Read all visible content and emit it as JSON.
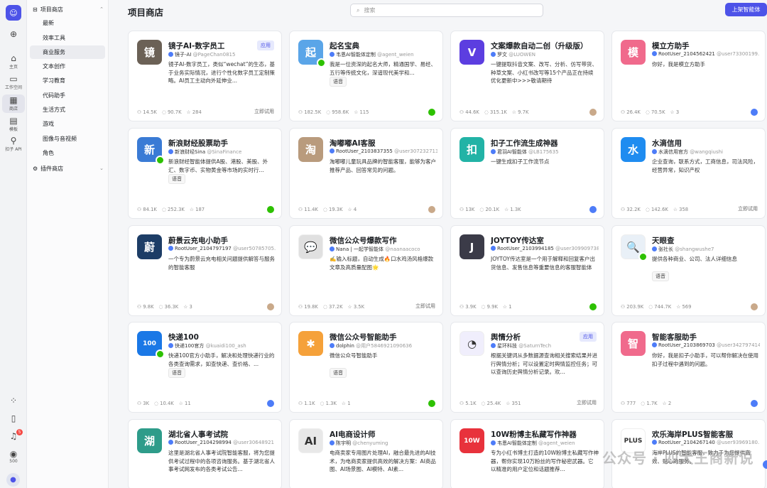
{
  "rail": {
    "items": [
      {
        "label": "主页",
        "icon": "home-icon"
      },
      {
        "label": "工作空间",
        "icon": "folder-icon"
      },
      {
        "label": "商店",
        "icon": "store-icon"
      },
      {
        "label": "模板",
        "icon": "template-icon"
      },
      {
        "label": "扣子 API",
        "icon": "api-icon"
      }
    ],
    "notif_count": "5",
    "points": "500"
  },
  "sidebar": {
    "project_store": "项目商店",
    "plugin_store": "插件商店",
    "items": [
      "最新",
      "效率工具",
      "商业服务",
      "文本创作",
      "学习教育",
      "代码助手",
      "生活方式",
      "游戏",
      "图像与音视频",
      "角色"
    ],
    "selected": 2
  },
  "header": {
    "title": "项目商店",
    "search_placeholder": "搜索",
    "publish_label": "上架智能体"
  },
  "cards": [
    {
      "name": "镜子AI-数字员工",
      "tag": "应用",
      "author": "镜子-AI",
      "handle": "@PageChan0815",
      "desc": "镜子AI-数字员工，类似“wechat”的生态，基于业务实际情况，进行个性化数字员工定制策略。AI员工主动向外延伸业...",
      "chip": "",
      "stats": [
        "14.5K",
        "90.7K",
        "284"
      ],
      "right": "立即试用",
      "icon_color": "#6b6156",
      "glyph": "镜",
      "wx": false
    },
    {
      "name": "起名宝典",
      "tag": "",
      "author": "韦恩AI智能体定制",
      "handle": "@agent_weien",
      "desc": "我是一位资深的起名大师，精通国学、易经、五行等传统文化，深谙现代美学和...",
      "chip": "语音",
      "stats": [
        "182.5K",
        "958.6K",
        "115"
      ],
      "right": "",
      "icon_color": "#5aa5e8",
      "glyph": "起",
      "wx": true
    },
    {
      "name": "文案爆款自动二创（升级版）",
      "tag": "",
      "author": "罗文",
      "handle": "@LUOWEN",
      "desc": "一键提取抖音文案、改写、分析、仿写带货、种草文案、小红书改写等15个产品正在持续优化更新中>>>敬请期待",
      "chip": "",
      "stats": [
        "44.6K",
        "315.1K",
        "9.7K"
      ],
      "right": "",
      "icon_color": "#5c3ee0",
      "glyph": "V",
      "wx": false
    },
    {
      "name": "模立方助手",
      "tag": "",
      "author": "RootUser_2104562421",
      "handle": "@user73300199...",
      "desc": "你好，我是模立方助手",
      "chip": "",
      "stats": [
        "26.4K",
        "70.5K",
        "3"
      ],
      "right": "",
      "icon_color": "#f06a8c",
      "glyph": "模",
      "wx": false
    },
    {
      "name": "新浪财经股票助手",
      "tag": "",
      "author": "新浪财经Sina",
      "handle": "@SinaFinance",
      "desc": "新浪财经智能体提供A股、港股、美股、外汇、数字币、实物黄金等市场的实时行...",
      "chip": "语音",
      "stats": [
        "84.1K",
        "252.3K",
        "187"
      ],
      "right": "",
      "icon_color": "#3a7bd5",
      "glyph": "新",
      "wx": true
    },
    {
      "name": "淘嘟嘟AI客服",
      "tag": "",
      "author": "RootUser_2103837355",
      "handle": "@user3072327131",
      "desc": "淘嘟嘟儿童玩具品牌的智能客服，能够为客户推荐产品、回答常见的问题。",
      "chip": "",
      "stats": [
        "11.4K",
        "19.3K",
        "4"
      ],
      "right": "",
      "icon_color": "#b99b7d",
      "glyph": "淘",
      "wx": false
    },
    {
      "name": "扣子工作流生成神器",
      "tag": "",
      "author": "君羽AI智能体",
      "handle": "@LB175635",
      "desc": "一键生成扣子工作流节点",
      "chip": "",
      "stats": [
        "13K",
        "20.1K",
        "1.3K"
      ],
      "right": "",
      "icon_color": "#22b3a6",
      "glyph": "扣",
      "wx": false
    },
    {
      "name": "水滴信用",
      "tag": "",
      "author": "水滴信用官方",
      "handle": "@wangqiushi",
      "desc": "企业查询，联系方式，工商信息，司法风险，经营异常，知识产权",
      "chip": "",
      "stats": [
        "32.2K",
        "142.6K",
        "358"
      ],
      "right": "立即试用",
      "icon_color": "#1f8cf0",
      "glyph": "水",
      "wx": false
    },
    {
      "name": "蔚景云充电小助手",
      "tag": "",
      "author": "RootUser_2104797197",
      "handle": "@user50785705...",
      "desc": "一个专为蔚景云充电相关问题提供解答与服务的智能客服",
      "chip": "",
      "stats": [
        "9.8K",
        "36.3K",
        "3"
      ],
      "right": "",
      "icon_color": "#1d3d66",
      "glyph": "蔚",
      "wx": false
    },
    {
      "name": "微信公众号爆款写作",
      "tag": "",
      "author": "Nana | 一起学智能体",
      "handle": "@naanaacoco",
      "desc": "✍️输入标题，自动生成🔥口水鸡汤风格爆款文章及高质量配图🌟",
      "chip": "",
      "stats": [
        "19.8K",
        "37.2K",
        "3.5K"
      ],
      "right": "立即试用",
      "icon_color": "#e0e0e0",
      "glyph": "💬",
      "wx": false
    },
    {
      "name": "JOYTOY传达室",
      "tag": "",
      "author": "RootUser_2103994185",
      "handle": "@user3099097381",
      "desc": "JOYTOY传达室是一个用于解释和回复客户出货信息、发售信息等重要信息的客服智能体",
      "chip": "",
      "stats": [
        "3.9K",
        "9.9K",
        "1"
      ],
      "right": "",
      "icon_color": "#3b3b48",
      "glyph": "J",
      "wx": false
    },
    {
      "name": "天眼查",
      "tag": "",
      "author": "张社长",
      "handle": "@shangwushe7",
      "desc": "提供各种商业、公司、法人详细信息",
      "chip": "语音",
      "stats": [
        "203.9K",
        "744.7K",
        "569"
      ],
      "right": "",
      "icon_color": "#e9f0f7",
      "glyph": "🔍",
      "wx": true
    },
    {
      "name": "快递100",
      "tag": "",
      "author": "快递100官方",
      "handle": "@kuaidi100_ash",
      "desc": "快递100官方小助手，解决和处理快递行业的各类查询需求，如查快递、查价格、...",
      "chip": "语音",
      "stats": [
        "3K",
        "10.4K",
        "11"
      ],
      "right": "",
      "icon_color": "#1a78e6",
      "glyph": "100",
      "wx": true
    },
    {
      "name": "微信公众号智能助手",
      "tag": "",
      "author": "dolphin",
      "handle": "@用户5846921090636",
      "desc": "微信公众号智能助手",
      "chip": "语音",
      "stats": [
        "1.1K",
        "1.3K",
        "1"
      ],
      "right": "",
      "icon_color": "#f5a13a",
      "glyph": "✱",
      "wx": false
    },
    {
      "name": "舆情分析",
      "tag": "应用",
      "author": "星环科技",
      "handle": "@SaturnTech",
      "desc": "根据关键词从多数据源查询相关搜索结果并进行舆情分析；可以设置定时舆情监控任务；可以查询历史舆情分析记录。欢...",
      "chip": "",
      "stats": [
        "5.1K",
        "25.4K",
        "351"
      ],
      "right": "立即试用",
      "icon_color": "#f0eefc",
      "glyph": "◔",
      "wx": false
    },
    {
      "name": "智能客服助手",
      "tag": "",
      "author": "RootUser_2103869703",
      "handle": "@user3427974147",
      "desc": "你好，我是扣子小助手，可以帮你解决在使用扣子过程中遇到的问题。",
      "chip": "",
      "stats": [
        "777",
        "1.7K",
        "2"
      ],
      "right": "",
      "icon_color": "#f06a8c",
      "glyph": "智",
      "wx": false
    },
    {
      "name": "湖北省人事考试院",
      "tag": "",
      "author": "RootUser_2104298994",
      "handle": "@user30648921",
      "desc": "这里是湖北省人事考试院智能客服，将为您提供考试过程中的各项咨询服务。基于湖北省人事考试网发布的各类考试公告...",
      "chip": "",
      "stats": [],
      "right": "",
      "icon_color": "#2e9c8a",
      "glyph": "湖",
      "wx": false
    },
    {
      "name": "AI电商设计师",
      "tag": "",
      "author": "陈宇明",
      "handle": "@chenyuming",
      "desc": "电商卖家专用图片处理AI，融合最先进的AI技术，为电商卖家提供高效的解决方案：AI商品图、AI场景图、AI模特、AI素...",
      "chip": "",
      "stats": [],
      "right": "",
      "icon_color": "#e8e8e8",
      "glyph": "AI",
      "wx": false
    },
    {
      "name": "10W粉博主私藏写作神器",
      "tag": "",
      "author": "韦恩AI智能体定制",
      "handle": "@agent_weien",
      "desc": "专为小红书博主打造的10W粉博主私藏写作神器，帮你实现10万粉丝的写作秘密武器。它以精准的用户定位和话题推荐...",
      "chip": "",
      "stats": [],
      "right": "",
      "icon_color": "#e8323c",
      "glyph": "10W",
      "wx": false
    },
    {
      "name": "欢乐海岸PLUS智能客服",
      "tag": "",
      "author": "RootUser_2104267140",
      "handle": "@user93969180...",
      "desc": "海岸PLUS的智能客服，致力于为您提供高效、贴心的服务。",
      "chip": "",
      "stats": [],
      "right": "",
      "icon_color": "#ffffff",
      "glyph": "PLUS",
      "wx": false
    }
  ],
  "watermark": "公众号 · 四大王商新说"
}
